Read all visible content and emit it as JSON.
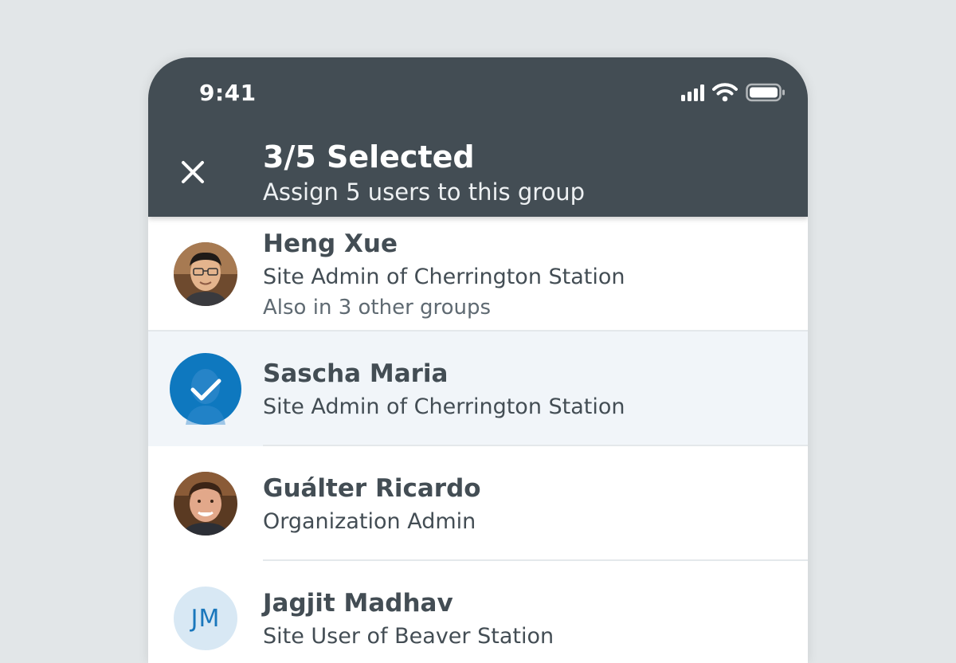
{
  "status_bar": {
    "time": "9:41",
    "icons": [
      "signal-icon",
      "wifi-icon",
      "battery-icon"
    ]
  },
  "header": {
    "close_icon": "close-icon",
    "title": "3/5 Selected",
    "subtitle": "Assign 5 users to this group"
  },
  "users": [
    {
      "name": "Heng Xue",
      "role": "Site Admin of Cherrington Station",
      "extra": "Also in 3 other groups",
      "avatar": "photo",
      "selected": false
    },
    {
      "name": "Sascha Maria",
      "role": "Site Admin of Cherrington Station",
      "avatar": "photo",
      "selected": true
    },
    {
      "name": "Guálter Ricardo",
      "role": "Organization Admin",
      "avatar": "photo",
      "selected": false
    },
    {
      "name": "Jagjit Madhav",
      "role": "Site User of Beaver Station",
      "avatar_initials": "JM",
      "selected": false
    }
  ],
  "colors": {
    "header_bg": "#434d54",
    "accent": "#0e78bf",
    "selected_row_bg": "#f1f5f9",
    "text_primary": "#434d54"
  }
}
